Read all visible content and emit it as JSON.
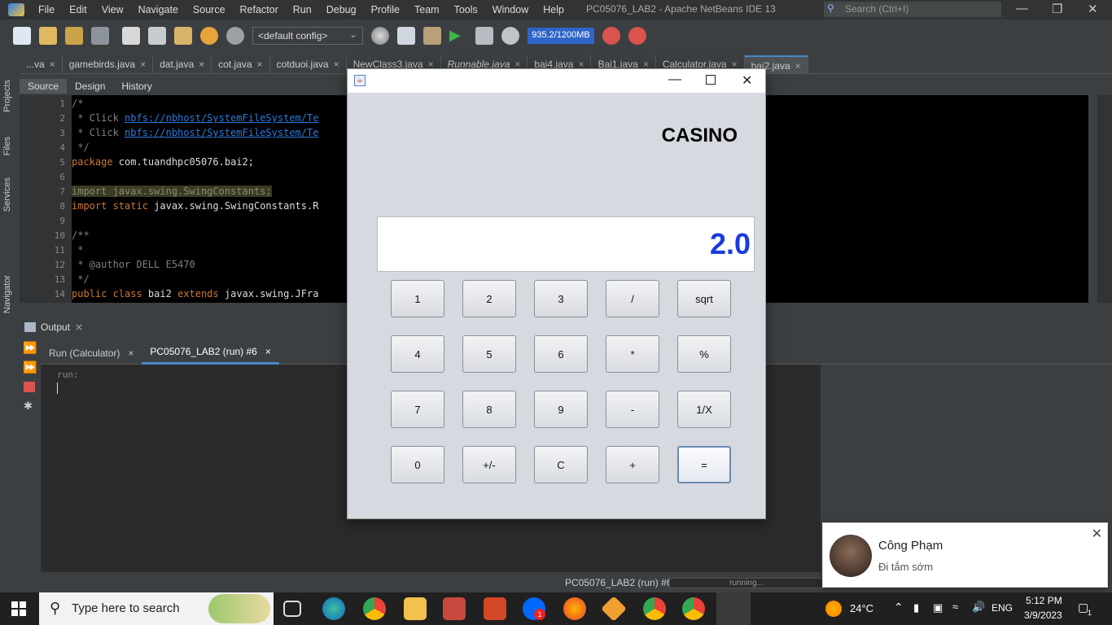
{
  "menubar": {
    "items": [
      "File",
      "Edit",
      "View",
      "Navigate",
      "Source",
      "Refactor",
      "Run",
      "Debug",
      "Profile",
      "Team",
      "Tools",
      "Window",
      "Help"
    ],
    "title": "PC05076_LAB2 - Apache NetBeans IDE 13",
    "search_placeholder": "Search (Ctrl+I)"
  },
  "toolbar": {
    "config": "<default config>",
    "memory": "935.2/1200MB"
  },
  "side_tabs": [
    "Projects",
    "Files",
    "Services",
    "Navigator"
  ],
  "file_tabs": [
    "...va",
    "gamebirds.java",
    "dat.java",
    "cot.java",
    "cotduoi.java",
    "NewClass3.java",
    "Runnable.java",
    "bai4.java",
    "Bai1.java",
    "Calculator.java",
    "bai2.java"
  ],
  "editor_tabs": [
    "Source",
    "Design",
    "History"
  ],
  "code": {
    "lines": [
      "1",
      "2",
      "3",
      "4",
      "5",
      "6",
      "7",
      "8",
      "9",
      "10",
      "11",
      "12",
      "13",
      "14"
    ],
    "l1": "/*",
    "l2_pre": " * Click ",
    "l2_link": "nbfs://nbhost/SystemFileSystem/Te",
    "l3_pre": " * Click ",
    "l3_link": "nbfs://nbhost/SystemFileSystem/Te",
    "l4": " */",
    "l5_kw": "package",
    "l5_rest": " com.tuandhpc05076.bai2;",
    "l7": "import javax.swing.SwingConstants;",
    "l8_kw": "import static",
    "l8_rest": " javax.swing.SwingConstants.R",
    "l10": "/**",
    "l11": " *",
    "l12": " * @author DELL E5470",
    "l13": " */",
    "l14_kw": "public class",
    "l14_mid": " bai2 ",
    "l14_kw2": "extends",
    "l14_rest": " javax.swing.JFra"
  },
  "output": {
    "title": "Output",
    "tabs": [
      "Run (Calculator)",
      "PC05076_LAB2 (run) #6"
    ],
    "console_text": "run:"
  },
  "status": {
    "text": "PC05076_LAB2 (run) #6",
    "progress_label": "running..."
  },
  "calculator": {
    "heading": "CASINO",
    "display": "2.0",
    "keys": [
      [
        "1",
        "2",
        "3",
        "/",
        "sqrt"
      ],
      [
        "4",
        "5",
        "6",
        "*",
        "%"
      ],
      [
        "7",
        "8",
        "9",
        "-",
        "1/X"
      ],
      [
        "0",
        "+/-",
        "C",
        "+",
        "="
      ]
    ]
  },
  "notification": {
    "name": "Công Phạm",
    "message": "Đi tắm sớm"
  },
  "taskbar": {
    "search": "Type here to search",
    "weather": "24°C",
    "lang": "ENG",
    "time": "5:12 PM",
    "date": "3/9/2023",
    "zalo_badge": "1",
    "notif_count": "1"
  }
}
